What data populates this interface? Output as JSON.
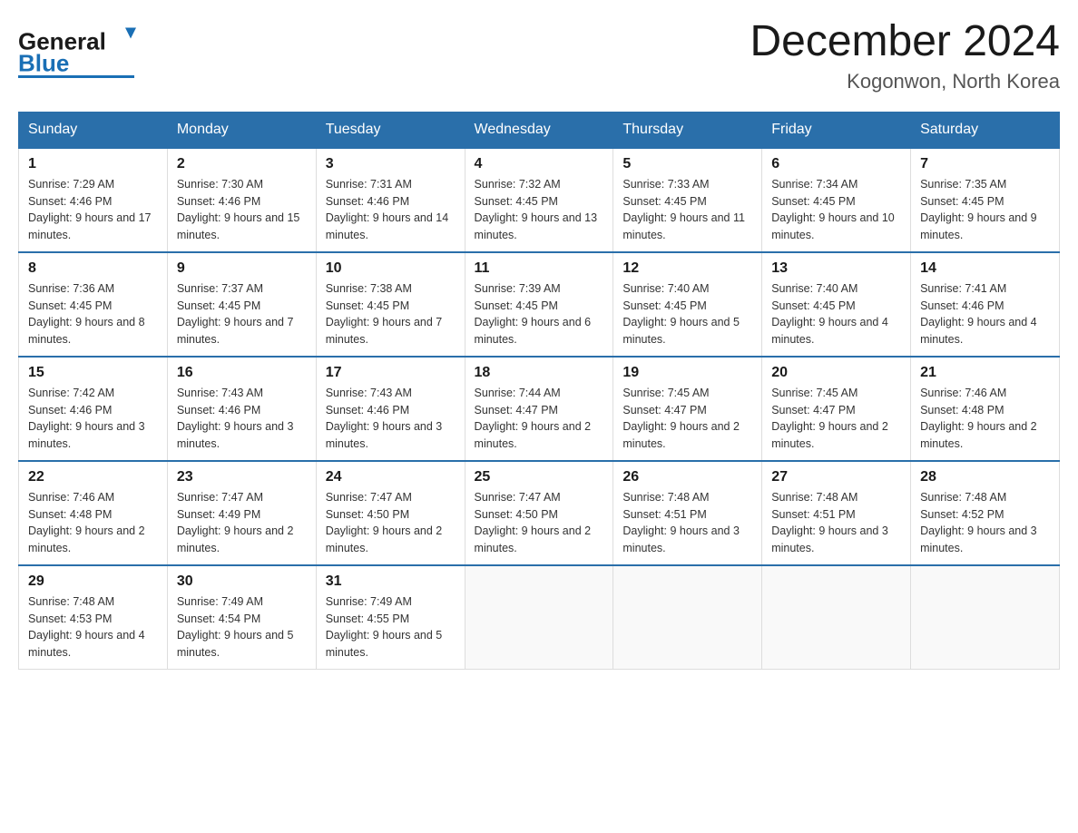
{
  "header": {
    "logo_general": "General",
    "logo_blue": "Blue",
    "month_title": "December 2024",
    "location": "Kogonwon, North Korea"
  },
  "weekdays": [
    "Sunday",
    "Monday",
    "Tuesday",
    "Wednesday",
    "Thursday",
    "Friday",
    "Saturday"
  ],
  "weeks": [
    [
      {
        "day": "1",
        "sunrise": "Sunrise: 7:29 AM",
        "sunset": "Sunset: 4:46 PM",
        "daylight": "Daylight: 9 hours and 17 minutes."
      },
      {
        "day": "2",
        "sunrise": "Sunrise: 7:30 AM",
        "sunset": "Sunset: 4:46 PM",
        "daylight": "Daylight: 9 hours and 15 minutes."
      },
      {
        "day": "3",
        "sunrise": "Sunrise: 7:31 AM",
        "sunset": "Sunset: 4:46 PM",
        "daylight": "Daylight: 9 hours and 14 minutes."
      },
      {
        "day": "4",
        "sunrise": "Sunrise: 7:32 AM",
        "sunset": "Sunset: 4:45 PM",
        "daylight": "Daylight: 9 hours and 13 minutes."
      },
      {
        "day": "5",
        "sunrise": "Sunrise: 7:33 AM",
        "sunset": "Sunset: 4:45 PM",
        "daylight": "Daylight: 9 hours and 11 minutes."
      },
      {
        "day": "6",
        "sunrise": "Sunrise: 7:34 AM",
        "sunset": "Sunset: 4:45 PM",
        "daylight": "Daylight: 9 hours and 10 minutes."
      },
      {
        "day": "7",
        "sunrise": "Sunrise: 7:35 AM",
        "sunset": "Sunset: 4:45 PM",
        "daylight": "Daylight: 9 hours and 9 minutes."
      }
    ],
    [
      {
        "day": "8",
        "sunrise": "Sunrise: 7:36 AM",
        "sunset": "Sunset: 4:45 PM",
        "daylight": "Daylight: 9 hours and 8 minutes."
      },
      {
        "day": "9",
        "sunrise": "Sunrise: 7:37 AM",
        "sunset": "Sunset: 4:45 PM",
        "daylight": "Daylight: 9 hours and 7 minutes."
      },
      {
        "day": "10",
        "sunrise": "Sunrise: 7:38 AM",
        "sunset": "Sunset: 4:45 PM",
        "daylight": "Daylight: 9 hours and 7 minutes."
      },
      {
        "day": "11",
        "sunrise": "Sunrise: 7:39 AM",
        "sunset": "Sunset: 4:45 PM",
        "daylight": "Daylight: 9 hours and 6 minutes."
      },
      {
        "day": "12",
        "sunrise": "Sunrise: 7:40 AM",
        "sunset": "Sunset: 4:45 PM",
        "daylight": "Daylight: 9 hours and 5 minutes."
      },
      {
        "day": "13",
        "sunrise": "Sunrise: 7:40 AM",
        "sunset": "Sunset: 4:45 PM",
        "daylight": "Daylight: 9 hours and 4 minutes."
      },
      {
        "day": "14",
        "sunrise": "Sunrise: 7:41 AM",
        "sunset": "Sunset: 4:46 PM",
        "daylight": "Daylight: 9 hours and 4 minutes."
      }
    ],
    [
      {
        "day": "15",
        "sunrise": "Sunrise: 7:42 AM",
        "sunset": "Sunset: 4:46 PM",
        "daylight": "Daylight: 9 hours and 3 minutes."
      },
      {
        "day": "16",
        "sunrise": "Sunrise: 7:43 AM",
        "sunset": "Sunset: 4:46 PM",
        "daylight": "Daylight: 9 hours and 3 minutes."
      },
      {
        "day": "17",
        "sunrise": "Sunrise: 7:43 AM",
        "sunset": "Sunset: 4:46 PM",
        "daylight": "Daylight: 9 hours and 3 minutes."
      },
      {
        "day": "18",
        "sunrise": "Sunrise: 7:44 AM",
        "sunset": "Sunset: 4:47 PM",
        "daylight": "Daylight: 9 hours and 2 minutes."
      },
      {
        "day": "19",
        "sunrise": "Sunrise: 7:45 AM",
        "sunset": "Sunset: 4:47 PM",
        "daylight": "Daylight: 9 hours and 2 minutes."
      },
      {
        "day": "20",
        "sunrise": "Sunrise: 7:45 AM",
        "sunset": "Sunset: 4:47 PM",
        "daylight": "Daylight: 9 hours and 2 minutes."
      },
      {
        "day": "21",
        "sunrise": "Sunrise: 7:46 AM",
        "sunset": "Sunset: 4:48 PM",
        "daylight": "Daylight: 9 hours and 2 minutes."
      }
    ],
    [
      {
        "day": "22",
        "sunrise": "Sunrise: 7:46 AM",
        "sunset": "Sunset: 4:48 PM",
        "daylight": "Daylight: 9 hours and 2 minutes."
      },
      {
        "day": "23",
        "sunrise": "Sunrise: 7:47 AM",
        "sunset": "Sunset: 4:49 PM",
        "daylight": "Daylight: 9 hours and 2 minutes."
      },
      {
        "day": "24",
        "sunrise": "Sunrise: 7:47 AM",
        "sunset": "Sunset: 4:50 PM",
        "daylight": "Daylight: 9 hours and 2 minutes."
      },
      {
        "day": "25",
        "sunrise": "Sunrise: 7:47 AM",
        "sunset": "Sunset: 4:50 PM",
        "daylight": "Daylight: 9 hours and 2 minutes."
      },
      {
        "day": "26",
        "sunrise": "Sunrise: 7:48 AM",
        "sunset": "Sunset: 4:51 PM",
        "daylight": "Daylight: 9 hours and 3 minutes."
      },
      {
        "day": "27",
        "sunrise": "Sunrise: 7:48 AM",
        "sunset": "Sunset: 4:51 PM",
        "daylight": "Daylight: 9 hours and 3 minutes."
      },
      {
        "day": "28",
        "sunrise": "Sunrise: 7:48 AM",
        "sunset": "Sunset: 4:52 PM",
        "daylight": "Daylight: 9 hours and 3 minutes."
      }
    ],
    [
      {
        "day": "29",
        "sunrise": "Sunrise: 7:48 AM",
        "sunset": "Sunset: 4:53 PM",
        "daylight": "Daylight: 9 hours and 4 minutes."
      },
      {
        "day": "30",
        "sunrise": "Sunrise: 7:49 AM",
        "sunset": "Sunset: 4:54 PM",
        "daylight": "Daylight: 9 hours and 5 minutes."
      },
      {
        "day": "31",
        "sunrise": "Sunrise: 7:49 AM",
        "sunset": "Sunset: 4:55 PM",
        "daylight": "Daylight: 9 hours and 5 minutes."
      },
      null,
      null,
      null,
      null
    ]
  ]
}
